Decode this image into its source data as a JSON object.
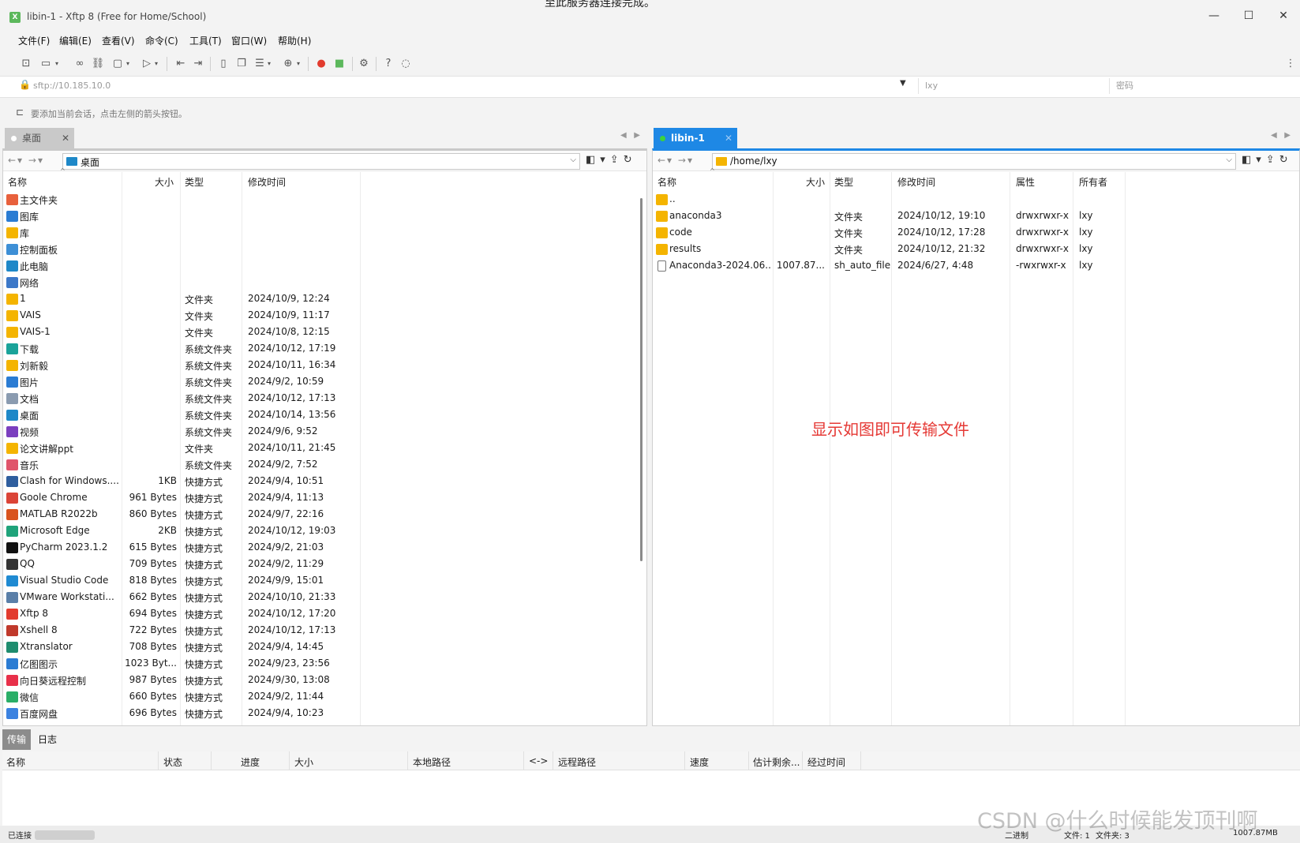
{
  "window": {
    "title": "libin-1 - Xftp 8 (Free for Home/School)",
    "background_cut_text": "至此服务器连接完成。",
    "minimize": "—",
    "maximize": "☐",
    "close": "✕"
  },
  "menu": [
    "文件(F)",
    "编辑(E)",
    "查看(V)",
    "命令(C)",
    "工具(T)",
    "窗口(W)",
    "帮助(H)"
  ],
  "address": {
    "url": "sftp://10.185.10.0",
    "username_placeholder": "lxy",
    "password_placeholder": "密码"
  },
  "hint": "要添加当前会话，点击左侧的箭头按钮。",
  "tabs": {
    "local": "桌面",
    "remote": "libin-1"
  },
  "local_pane": {
    "path": "桌面",
    "headers": {
      "name": "名称",
      "size": "大小",
      "type": "类型",
      "modified": "修改时间"
    },
    "rows": [
      {
        "name": "主文件夹",
        "size": "",
        "type": "",
        "modified": "",
        "icon": "home-icon",
        "color": "#e8603c"
      },
      {
        "name": "图库",
        "size": "",
        "type": "",
        "modified": "",
        "icon": "gallery-icon",
        "color": "#2b7cd3"
      },
      {
        "name": "库",
        "size": "",
        "type": "",
        "modified": "",
        "icon": "folder-icon",
        "color": "#f4b400"
      },
      {
        "name": "控制面板",
        "size": "",
        "type": "",
        "modified": "",
        "icon": "control-panel-icon",
        "color": "#3d8fd6"
      },
      {
        "name": "此电脑",
        "size": "",
        "type": "",
        "modified": "",
        "icon": "computer-icon",
        "color": "#1e88c8"
      },
      {
        "name": "网络",
        "size": "",
        "type": "",
        "modified": "",
        "icon": "network-icon",
        "color": "#3c78c8"
      },
      {
        "name": "1",
        "size": "",
        "type": "文件夹",
        "modified": "2024/10/9, 12:24",
        "icon": "folder-icon",
        "color": "#f4b400"
      },
      {
        "name": "VAIS",
        "size": "",
        "type": "文件夹",
        "modified": "2024/10/9, 11:17",
        "icon": "folder-icon",
        "color": "#f4b400"
      },
      {
        "name": "VAIS-1",
        "size": "",
        "type": "文件夹",
        "modified": "2024/10/8, 12:15",
        "icon": "folder-icon",
        "color": "#f4b400"
      },
      {
        "name": "下载",
        "size": "",
        "type": "系统文件夹",
        "modified": "2024/10/12, 17:19",
        "icon": "download-icon",
        "color": "#1aa39a"
      },
      {
        "name": "刘新毅",
        "size": "",
        "type": "系统文件夹",
        "modified": "2024/10/11, 16:34",
        "icon": "folder-icon",
        "color": "#f4b400"
      },
      {
        "name": "图片",
        "size": "",
        "type": "系统文件夹",
        "modified": "2024/9/2, 10:59",
        "icon": "pictures-icon",
        "color": "#2b7cd3"
      },
      {
        "name": "文档",
        "size": "",
        "type": "系统文件夹",
        "modified": "2024/10/12, 17:13",
        "icon": "documents-icon",
        "color": "#8a9bb0"
      },
      {
        "name": "桌面",
        "size": "",
        "type": "系统文件夹",
        "modified": "2024/10/14, 13:56",
        "icon": "desktop-icon",
        "color": "#1e88c8"
      },
      {
        "name": "视频",
        "size": "",
        "type": "系统文件夹",
        "modified": "2024/9/6, 9:52",
        "icon": "videos-icon",
        "color": "#7b3fbf"
      },
      {
        "name": "论文讲解ppt",
        "size": "",
        "type": "文件夹",
        "modified": "2024/10/11, 21:45",
        "icon": "folder-icon",
        "color": "#f4b400"
      },
      {
        "name": "音乐",
        "size": "",
        "type": "系统文件夹",
        "modified": "2024/9/2, 7:52",
        "icon": "music-icon",
        "color": "#e0556b"
      },
      {
        "name": "Clash for Windows....",
        "size": "1KB",
        "type": "快捷方式",
        "modified": "2024/9/4, 10:51",
        "icon": "clash-icon",
        "color": "#2f5e9e"
      },
      {
        "name": "Goole Chrome",
        "size": "961 Bytes",
        "type": "快捷方式",
        "modified": "2024/9/4, 11:13",
        "icon": "chrome-icon",
        "color": "#db4437"
      },
      {
        "name": "MATLAB R2022b",
        "size": "860 Bytes",
        "type": "快捷方式",
        "modified": "2024/9/7, 22:16",
        "icon": "matlab-icon",
        "color": "#d9531e"
      },
      {
        "name": "Microsoft Edge",
        "size": "2KB",
        "type": "快捷方式",
        "modified": "2024/10/12, 19:03",
        "icon": "edge-icon",
        "color": "#1fa37a"
      },
      {
        "name": "PyCharm 2023.1.2",
        "size": "615 Bytes",
        "type": "快捷方式",
        "modified": "2024/9/2, 21:03",
        "icon": "pycharm-icon",
        "color": "#111111"
      },
      {
        "name": "QQ",
        "size": "709 Bytes",
        "type": "快捷方式",
        "modified": "2024/9/2, 11:29",
        "icon": "qq-icon",
        "color": "#333333"
      },
      {
        "name": "Visual Studio Code",
        "size": "818 Bytes",
        "type": "快捷方式",
        "modified": "2024/9/9, 15:01",
        "icon": "vscode-icon",
        "color": "#1f8ad2"
      },
      {
        "name": "VMware Workstati...",
        "size": "662 Bytes",
        "type": "快捷方式",
        "modified": "2024/10/10, 21:33",
        "icon": "vmware-icon",
        "color": "#5a7fa8"
      },
      {
        "name": "Xftp 8",
        "size": "694 Bytes",
        "type": "快捷方式",
        "modified": "2024/10/12, 17:20",
        "icon": "xftp-icon",
        "color": "#e23b2e"
      },
      {
        "name": "Xshell 8",
        "size": "722 Bytes",
        "type": "快捷方式",
        "modified": "2024/10/12, 17:13",
        "icon": "xshell-icon",
        "color": "#c0392b"
      },
      {
        "name": "Xtranslator",
        "size": "708 Bytes",
        "type": "快捷方式",
        "modified": "2024/9/4, 14:45",
        "icon": "xtranslator-icon",
        "color": "#1e8c6e"
      },
      {
        "name": "亿图图示",
        "size": "1023 Byt...",
        "type": "快捷方式",
        "modified": "2024/9/23, 23:56",
        "icon": "edraw-icon",
        "color": "#2b7cd3"
      },
      {
        "name": "向日葵远程控制",
        "size": "987 Bytes",
        "type": "快捷方式",
        "modified": "2024/9/30, 13:08",
        "icon": "sunflower-icon",
        "color": "#e8304a"
      },
      {
        "name": "微信",
        "size": "660 Bytes",
        "type": "快捷方式",
        "modified": "2024/9/2, 11:44",
        "icon": "wechat-icon",
        "color": "#2aae67"
      },
      {
        "name": "百度网盘",
        "size": "696 Bytes",
        "type": "快捷方式",
        "modified": "2024/9/4, 10:23",
        "icon": "baidu-netdisk-icon",
        "color": "#3b82e0"
      }
    ]
  },
  "remote_pane": {
    "path": "/home/lxy",
    "headers": {
      "name": "名称",
      "size": "大小",
      "type": "类型",
      "modified": "修改时间",
      "perm": "属性",
      "owner": "所有者"
    },
    "rows": [
      {
        "name": "..",
        "size": "",
        "type": "",
        "modified": "",
        "perm": "",
        "owner": "",
        "icon": "folder-icon",
        "color": "#f4b400"
      },
      {
        "name": "anaconda3",
        "size": "",
        "type": "文件夹",
        "modified": "2024/10/12, 19:10",
        "perm": "drwxrwxr-x",
        "owner": "lxy",
        "icon": "folder-icon",
        "color": "#f4b400"
      },
      {
        "name": "code",
        "size": "",
        "type": "文件夹",
        "modified": "2024/10/12, 17:28",
        "perm": "drwxrwxr-x",
        "owner": "lxy",
        "icon": "folder-icon",
        "color": "#f4b400"
      },
      {
        "name": "results",
        "size": "",
        "type": "文件夹",
        "modified": "2024/10/12, 21:32",
        "perm": "drwxrwxr-x",
        "owner": "lxy",
        "icon": "folder-icon",
        "color": "#f4b400"
      },
      {
        "name": "Anaconda3-2024.06...",
        "size": "1007.87...",
        "type": "sh_auto_file",
        "modified": "2024/6/27, 4:48",
        "perm": "-rwxrwxr-x",
        "owner": "lxy",
        "icon": "file-icon",
        "color": "#ffffff"
      }
    ]
  },
  "annotation": "显示如图即可传输文件",
  "bottom": {
    "tabs": [
      "传输",
      "日志"
    ],
    "headers": [
      "名称",
      "状态",
      "进度",
      "大小",
      "本地路径",
      "<->",
      "远程路径",
      "速度",
      "估计剩余...",
      "经过时间"
    ]
  },
  "status": {
    "connected": "已连接",
    "mode": "二进制",
    "files": "文件: 1",
    "folders": "文件夹: 3",
    "size": "1007.87MB"
  },
  "watermark": "CSDN @什么时候能发顶刊啊",
  "colors": {
    "accent": "#1e88e5",
    "annotation": "#e53935",
    "folder": "#f4b400"
  }
}
